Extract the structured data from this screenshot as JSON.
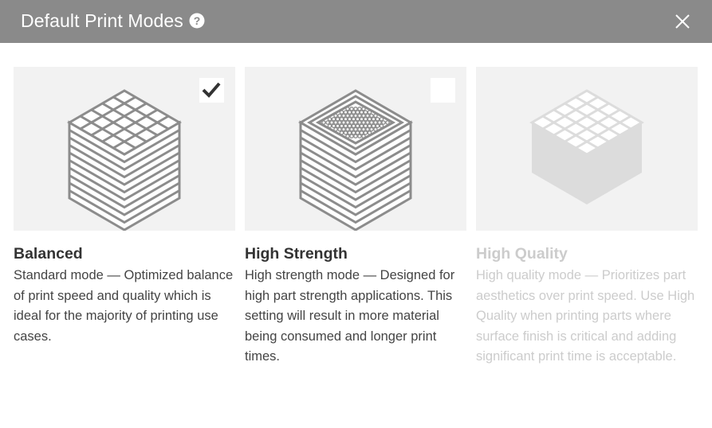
{
  "dialog": {
    "title": "Default Print Modes",
    "help_icon": "question-circle-icon",
    "close_icon": "close-x-icon"
  },
  "modes": [
    {
      "title": "Balanced",
      "description": "Standard mode — Optimized balance of print speed and quality which is ideal for the majority of printing use cases.",
      "selected": true,
      "disabled": false,
      "icon": "layered-cube-grid-icon"
    },
    {
      "title": "High Strength",
      "description": "High strength mode — Designed for high part strength applications. This setting will result in more material being consumed and longer print times.",
      "selected": false,
      "disabled": false,
      "icon": "layered-cube-dense-infill-icon"
    },
    {
      "title": "High Quality",
      "description": "High quality mode — Prioritizes part aesthetics over print speed. Use High Quality when printing parts where surface finish is critical and adding significant print time is acceptable.",
      "selected": false,
      "disabled": true,
      "icon": "solid-cube-grid-icon"
    }
  ],
  "colors": {
    "header_bg": "#8a8a8a",
    "card_bg": "#f2f2f2",
    "icon_gray": "#8c8c8c",
    "disabled_gray": "#d9d9d9"
  }
}
